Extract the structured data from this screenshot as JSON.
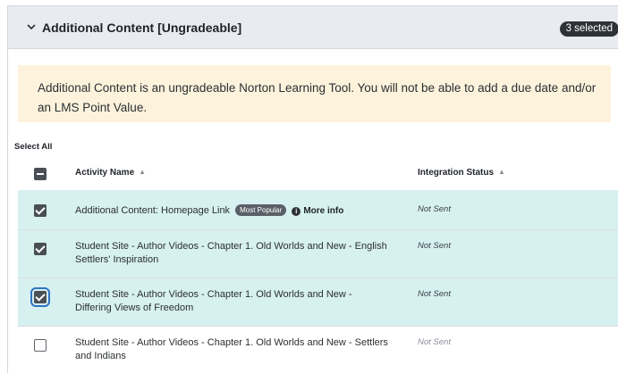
{
  "section": {
    "title": "Additional Content [Ungradeable]",
    "selected_badge": "3 selected",
    "icon": "chevron-down-icon"
  },
  "notice": {
    "text": "Additional Content is an ungradeable Norton Learning Tool. You will not be able to add a due date and/or an LMS Point Value."
  },
  "table": {
    "select_all_label": "Select All",
    "columns": {
      "activity": "Activity Name",
      "status": "Integration Status"
    },
    "rows": [
      {
        "name": "Additional Content: Homepage Link",
        "badge": "Most Popular",
        "more_info": "More info",
        "status": "Not Sent",
        "checked": true
      },
      {
        "name": "Student Site - Author Videos - Chapter 1. Old Worlds and New - English Settlers' Inspiration",
        "status": "Not Sent",
        "checked": true
      },
      {
        "name": "Student Site - Author Videos - Chapter 1. Old Worlds and New - Differing Views of Freedom",
        "status": "Not Sent",
        "checked": true,
        "focused": true
      },
      {
        "name": "Student Site - Author Videos - Chapter 1. Old Worlds and New - Settlers and Indians",
        "status": "Not Sent",
        "checked": false
      }
    ]
  },
  "colors": {
    "header_bg": "#e8ecf1",
    "notice_bg": "#fdf3dc",
    "selected_row_bg": "#d7f0f0",
    "badge_bg": "#2e3338",
    "focus_ring": "#2f74c0"
  }
}
